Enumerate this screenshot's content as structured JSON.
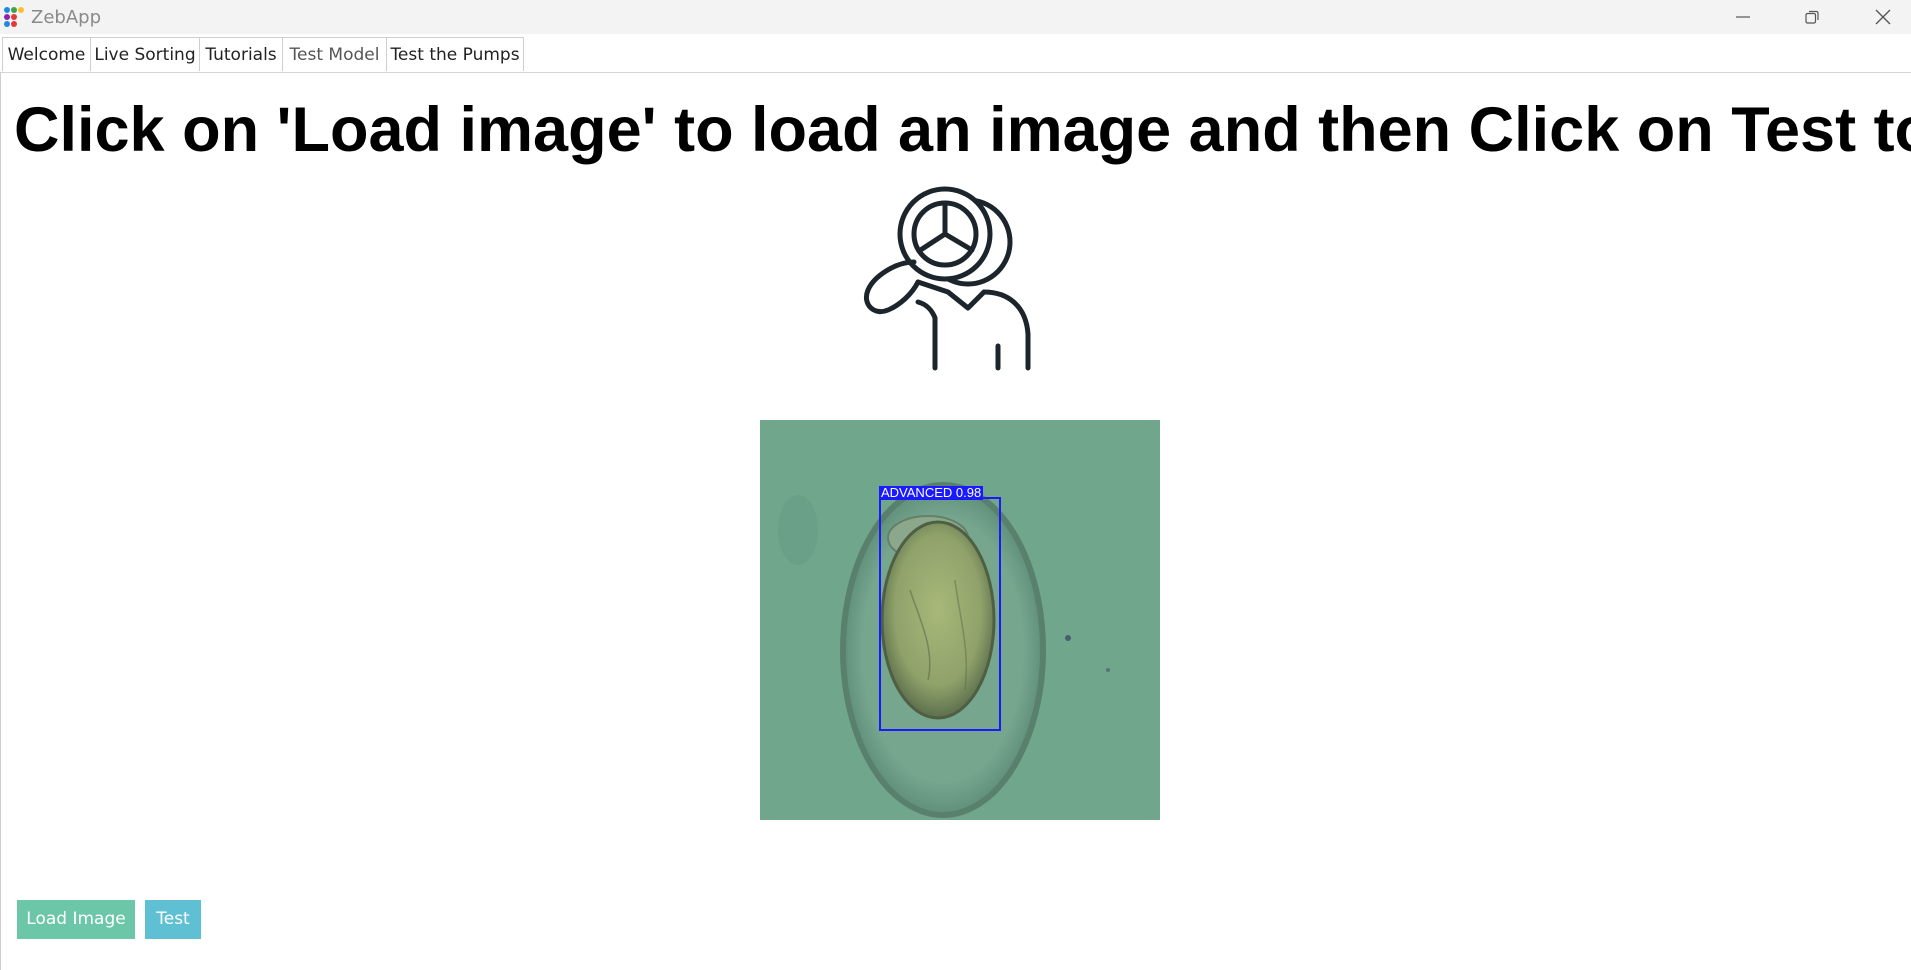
{
  "app": {
    "title": "ZebApp",
    "icon": "app-dots-icon"
  },
  "window_controls": {
    "minimize_icon": "minimize-icon",
    "restore_icon": "restore-icon",
    "close_icon": "close-icon"
  },
  "tabs": [
    {
      "label": "Welcome"
    },
    {
      "label": "Live Sorting"
    },
    {
      "label": "Tutorials"
    },
    {
      "label": "Test Model",
      "selected": true
    },
    {
      "label": "Test the Pumps"
    }
  ],
  "main": {
    "instruction": "Click on 'Load image' to load an image and then Click on Test to d",
    "illustration_icon": "person-magnifier-icon",
    "detection": {
      "label": "ADVANCED  0.98",
      "box_color": "#1a1aff"
    }
  },
  "buttons": {
    "load_image": "Load Image",
    "test": "Test"
  },
  "colors": {
    "load_button": "#6cc6a8",
    "test_button": "#5fc0d4",
    "image_background": "#6fa68c"
  }
}
